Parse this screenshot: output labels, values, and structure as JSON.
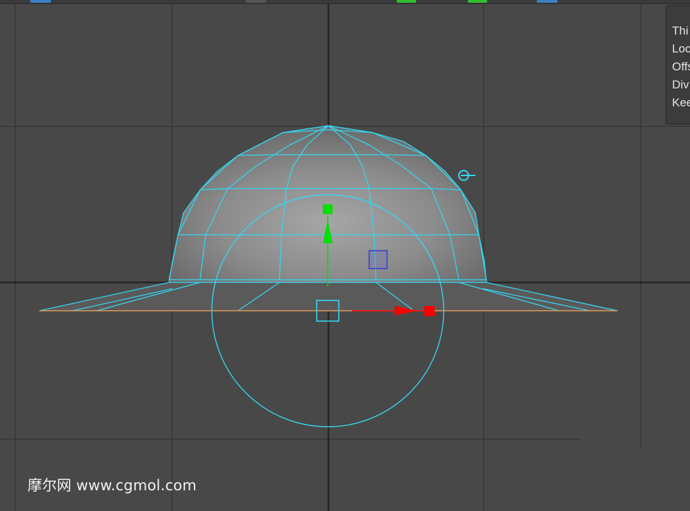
{
  "viewport": {
    "background_color": "#484848",
    "grid_color": "#3a3a3a",
    "axis_color": "#262626"
  },
  "toolbar": {
    "chips": [
      {
        "name": "toolbar-button-1",
        "color": "#3b7fc4"
      },
      {
        "name": "toolbar-button-2",
        "color": "#555555"
      },
      {
        "name": "toolbar-green-indicator-1",
        "color": "#2fbf2f"
      },
      {
        "name": "toolbar-green-indicator-2",
        "color": "#2fbf2f"
      },
      {
        "name": "toolbar-button-3",
        "color": "#3b7fc4"
      }
    ]
  },
  "attribute_panel": {
    "rows": [
      {
        "name": "attr-row-thickness",
        "label": "Thi"
      },
      {
        "name": "attr-row-local",
        "label": "Loc"
      },
      {
        "name": "attr-row-offset",
        "label": "Offs"
      },
      {
        "name": "attr-row-divisions",
        "label": "Div"
      },
      {
        "name": "attr-row-keep",
        "label": "Kee"
      }
    ]
  },
  "model": {
    "wireframe_color": "#35d6f0",
    "face_color_light": "#a2a2a2",
    "face_color_dark": "#6a6a6a",
    "selected_edge_color": "#e09a5a"
  },
  "manipulator": {
    "x_axis_color": "#ff0000",
    "y_axis_color": "#00e000",
    "plane_handle_color": "#3a3ad6",
    "rotate_ring_color": "#35d6f0",
    "pivot_icon": "pivot-icon"
  },
  "watermark": {
    "text": "摩尔网 www.cgmol.com"
  }
}
